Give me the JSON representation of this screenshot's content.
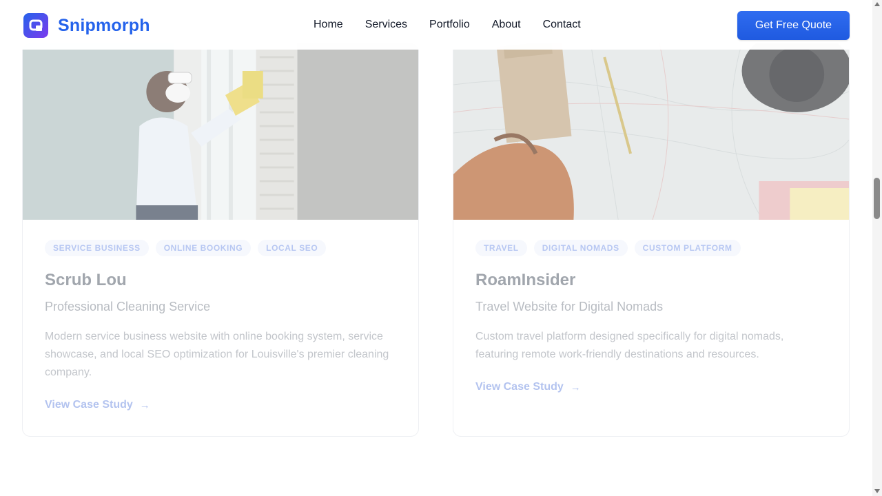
{
  "header": {
    "brand": "Snipmorph",
    "nav": [
      "Home",
      "Services",
      "Portfolio",
      "About",
      "Contact"
    ],
    "cta_label": "Get Free Quote"
  },
  "colors": {
    "accent": "#2563eb",
    "tag_text": "#b7c7f2",
    "muted_text": "#c3c6cb"
  },
  "cards": [
    {
      "image_icon": "cleaning-photo",
      "tags": [
        "SERVICE BUSINESS",
        "ONLINE BOOKING",
        "LOCAL SEO"
      ],
      "title": "Scrub Lou",
      "subtitle": "Professional Cleaning Service",
      "description": "Modern service business website with online booking system, service showcase, and local SEO optimization for Louisville's premier cleaning company.",
      "link_label": "View Case Study"
    },
    {
      "image_icon": "travel-map-photo",
      "tags": [
        "TRAVEL",
        "DIGITAL NOMADS",
        "CUSTOM PLATFORM"
      ],
      "title": "RoamInsider",
      "subtitle": "Travel Website for Digital Nomads",
      "description": "Custom travel platform designed specifically for digital nomads, featuring remote work-friendly destinations and resources.",
      "link_label": "View Case Study"
    }
  ]
}
